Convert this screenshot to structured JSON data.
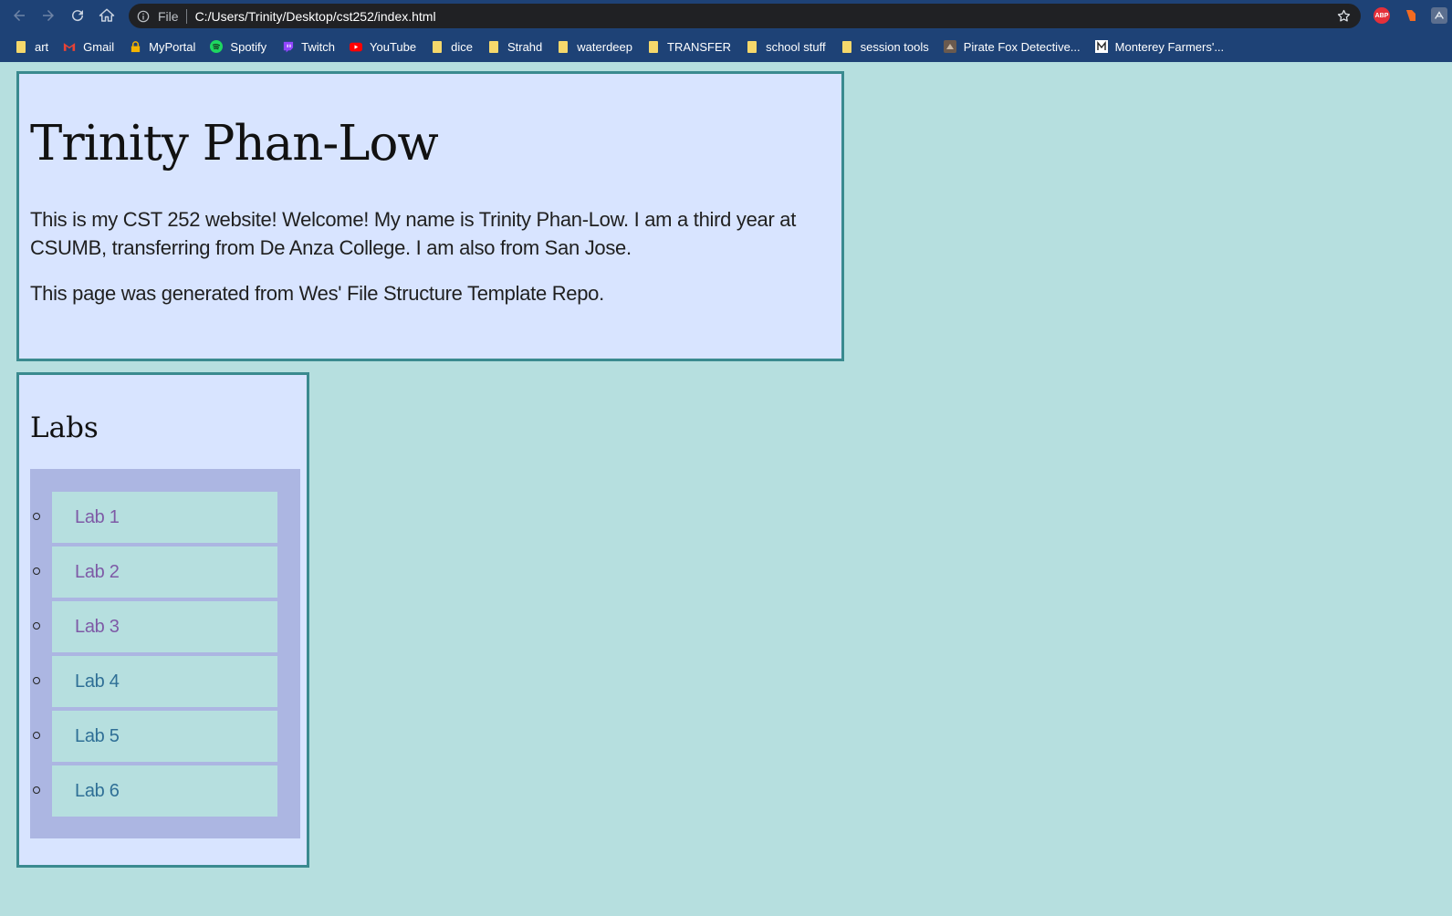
{
  "browser": {
    "file_label": "File",
    "url": "C:/Users/Trinity/Desktop/cst252/index.html",
    "extensions": {
      "abp": "ABP"
    },
    "bookmarks": [
      {
        "label": "art",
        "icon": "folder-icon"
      },
      {
        "label": "Gmail",
        "icon": "gmail-icon"
      },
      {
        "label": "MyPortal",
        "icon": "lock-icon"
      },
      {
        "label": "Spotify",
        "icon": "spotify-icon"
      },
      {
        "label": "Twitch",
        "icon": "twitch-icon"
      },
      {
        "label": "YouTube",
        "icon": "youtube-icon"
      },
      {
        "label": "dice",
        "icon": "folder-icon"
      },
      {
        "label": "Strahd",
        "icon": "folder-icon"
      },
      {
        "label": "waterdeep",
        "icon": "folder-icon"
      },
      {
        "label": "TRANSFER",
        "icon": "folder-icon"
      },
      {
        "label": "school stuff",
        "icon": "folder-icon"
      },
      {
        "label": "session tools",
        "icon": "folder-icon"
      },
      {
        "label": "Pirate Fox Detective...",
        "icon": "pirate-fox-icon"
      },
      {
        "label": "Monterey Farmers'...",
        "icon": "monterey-icon"
      }
    ]
  },
  "page": {
    "name": "Trinity Phan-Low",
    "intro": "This is my CST 252 website! Welcome! My name is Trinity Phan-Low. I am a third year at CSUMB, transferring from De Anza College. I am also from San Jose.",
    "template_note": "This page was generated from Wes' File Structure Template Repo.",
    "labs_heading": "Labs",
    "labs": [
      {
        "label": "Lab 1",
        "visited": true
      },
      {
        "label": "Lab 2",
        "visited": true
      },
      {
        "label": "Lab 3",
        "visited": true
      },
      {
        "label": "Lab 4",
        "visited": false
      },
      {
        "label": "Lab 5",
        "visited": false
      },
      {
        "label": "Lab 6",
        "visited": false
      }
    ]
  },
  "colors": {
    "page_background": "#b6dfdf",
    "card_background": "#d8e4ff",
    "card_border": "#3a8a8f",
    "list_background": "#acb6e2",
    "visited_link": "#7e5aa6",
    "unvisited_link": "#2f6f96",
    "browser_chrome": "#1e4276"
  }
}
